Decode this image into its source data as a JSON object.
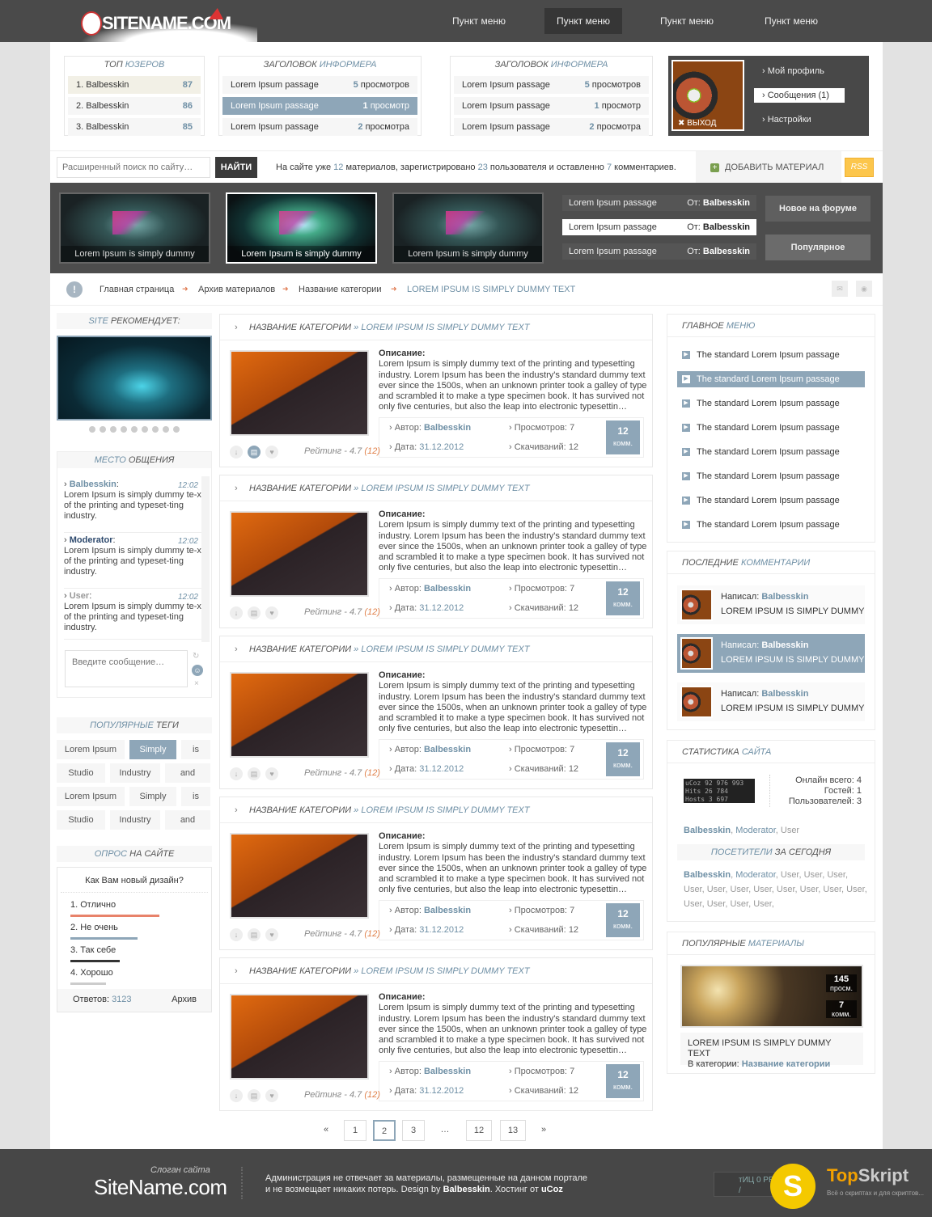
{
  "header": {
    "logo": "SITENAME.COM",
    "nav": [
      "Пункт меню",
      "Пункт меню",
      "Пункт меню",
      "Пункт меню"
    ]
  },
  "top_users": {
    "title_a": "Топ",
    "title_b": "юзеров",
    "rows": [
      {
        "name": "1. Balbesskin",
        "score": "87"
      },
      {
        "name": "2. Balbesskin",
        "score": "86"
      },
      {
        "name": "3. Balbesskin",
        "score": "85"
      }
    ]
  },
  "informer1": {
    "title_a": "Заголовок",
    "title_b": "информера",
    "rows": [
      {
        "text": "Lorem Ipsum passage",
        "n": "5",
        "u": "просмотров"
      },
      {
        "text": "Lorem Ipsum passage",
        "n": "1",
        "u": "просмотр"
      },
      {
        "text": "Lorem Ipsum passage",
        "n": "2",
        "u": "просмотра"
      }
    ]
  },
  "informer2": {
    "title_a": "Заголовок",
    "title_b": "информера",
    "rows": [
      {
        "text": "Lorem Ipsum passage",
        "n": "5",
        "u": "просмотров"
      },
      {
        "text": "Lorem Ipsum passage",
        "n": "1",
        "u": "просмотр"
      },
      {
        "text": "Lorem Ipsum passage",
        "n": "2",
        "u": "просмотра"
      }
    ]
  },
  "profile": {
    "logout": "ВЫХОД",
    "links": [
      "Мой профиль",
      "Сообщения (1)",
      "Настройки"
    ]
  },
  "search": {
    "placeholder": "Расширенный поиск по сайту…",
    "button": "НАЙТИ",
    "info_a": "На сайте уже",
    "materials": "12",
    "info_b": "материалов, зарегистрировано",
    "users": "23",
    "info_c": "пользователя и оставленно",
    "comments": "7",
    "info_d": "комментариев.",
    "add": "ДОБАВИТЬ МАТЕРИАЛ",
    "rss": "RSS"
  },
  "slider": {
    "captions": [
      "Lorem Ipsum is simply dummy",
      "Lorem Ipsum is simply dummy",
      "Lorem Ipsum is simply dummy"
    ],
    "forum": [
      {
        "text": "Lorem Ipsum passage",
        "from": "От:",
        "user": "Balbesskin"
      },
      {
        "text": "Lorem Ipsum passage",
        "from": "От:",
        "user": "Balbesskin"
      },
      {
        "text": "Lorem Ipsum passage",
        "from": "От:",
        "user": "Balbesskin"
      }
    ],
    "btn_new": "Новое на форуме",
    "btn_pop": "Популярное"
  },
  "breadcrumb": [
    "Главная страница",
    "Архив материалов",
    "Название категории",
    "LOREM IPSUM IS SIMPLY DUMMY TEXT"
  ],
  "left": {
    "recommends_a": "Site",
    "recommends_b": "рекомендует:",
    "chat_a": "Место",
    "chat_b": "общения",
    "chat": [
      {
        "user": "Balbesskin",
        "time": "12:02",
        "text": "Lorem Ipsum is simply dummy te-xt of the printing and typeset-ting industry."
      },
      {
        "user": "Moderator",
        "time": "12:02",
        "text": "Lorem Ipsum is simply dummy te-xt of the printing and typeset-ting industry."
      },
      {
        "user": "User",
        "time": "12:02",
        "text": "Lorem Ipsum is simply dummy te-xt of the printing and typeset-ting industry."
      }
    ],
    "chat_placeholder": "Введите сообщение…",
    "tags_a": "Популярные",
    "tags_b": "теги",
    "tags": [
      "Lorem Ipsum",
      "Simply",
      "is",
      "Studio",
      "Industry",
      "and",
      "Lorem Ipsum",
      "Simply",
      "is",
      "Studio",
      "Industry",
      "and"
    ],
    "poll_a": "Опрос",
    "poll_b": "на сайте",
    "poll_q": "Как Вам новый дизайн?",
    "poll": [
      {
        "label": "1. Отлично",
        "color": "#e8826a",
        "share": 1.0
      },
      {
        "label": "2. Не очень",
        "color": "#8ea6b8",
        "share": 0.75
      },
      {
        "label": "3. Так себе",
        "color": "#333333",
        "share": 0.55
      },
      {
        "label": "4. Хорошо",
        "color": "#cccccc",
        "share": 0.4
      }
    ],
    "answers_label": "Ответов:",
    "answers": "3123",
    "archive": "Архив"
  },
  "article": {
    "cat": "Название категории",
    "title": "» LOREM IPSUM IS SIMPLY DUMMY TEXT",
    "desc_label": "Описание:",
    "desc": "Lorem Ipsum is simply dummy text of the printing and typesetting industry. Lorem Ipsum has been the industry's standard dummy text ever since the 1500s, when an unknown printer took a galley of type and scrambled it to make a type specimen book. It has survived not only five centuries, but also the leap into electronic typesettin…",
    "author_label": "Автор:",
    "author": "Balbesskin",
    "views_label": "Просмотров:",
    "views": "7",
    "date_label": "Дата:",
    "date": "31.12.2012",
    "dl_label": "Скачиваний:",
    "dl": "12",
    "comments": "12",
    "comments_unit": "комм.",
    "rating_label": "Рейтинг -",
    "rating": "4.7",
    "votes": "(12)"
  },
  "pagination": [
    "«",
    "1",
    "2",
    "3",
    "…",
    "12",
    "13",
    "»"
  ],
  "right": {
    "menu_a": "Главное",
    "menu_b": "меню",
    "menu": [
      "The standard Lorem Ipsum passage",
      "The standard Lorem Ipsum passage",
      "The standard Lorem Ipsum passage",
      "The standard Lorem Ipsum passage",
      "The standard Lorem Ipsum passage",
      "The standard Lorem Ipsum passage",
      "The standard Lorem Ipsum passage",
      "The standard Lorem Ipsum passage"
    ],
    "comments_a": "Последние",
    "comments_b": "комментарии",
    "comments": [
      {
        "label": "Написал:",
        "user": "Balbesskin",
        "text": "LOREM IPSUM IS SIMPLY DUMMY"
      },
      {
        "label": "Написал:",
        "user": "Balbesskin",
        "text": "LOREM IPSUM IS SIMPLY DUMMY"
      },
      {
        "label": "Написал:",
        "user": "Balbesskin",
        "text": "LOREM IPSUM IS SIMPLY DUMMY"
      }
    ],
    "stats_a": "Статистика",
    "stats_b": "сайта",
    "counter_lines": [
      "uCoz 92 976 993",
      "Hits 26 784",
      "Hosts 3 697"
    ],
    "online": "Онлайн всего: 4",
    "guests": "Гостей: 1",
    "members": "Пользователей: 3",
    "online_users": {
      "b": "Balbesskin",
      "m": "Moderator",
      "u": "User"
    },
    "visitors_a": "Посетители",
    "visitors_b": "за сегодня",
    "visitors_rest": "User, User, User, User, User, User, User, User, User, User, User, User, User, User, User,",
    "pop_a": "Популярные",
    "pop_b": "материалы",
    "pop_views": "145",
    "pop_views_unit": "просм.",
    "pop_comments": "7",
    "pop_comments_unit": "комм.",
    "pop_title": "LOREM IPSUM IS SIMPLY DUMMY TEXT",
    "pop_cat_label": "В категории:",
    "pop_cat": "Название категории"
  },
  "footer": {
    "slogan": "Слоган сайта",
    "name": "SiteName.com",
    "line1": "Администрация не отвечает за материалы, размещенные на данном портале",
    "line2a": "и не возмещает никаких потерь. Design by",
    "designer": "Balbesskin",
    "line2b": ". Хостинг от",
    "host": "uCoz",
    "counter": "тИЦ 0 PR: 2 /",
    "brand_s": "S",
    "brand_top": "Top",
    "brand_skript": "Skript",
    "brand_sub": "Всё о скриптах и для скриптов..."
  }
}
